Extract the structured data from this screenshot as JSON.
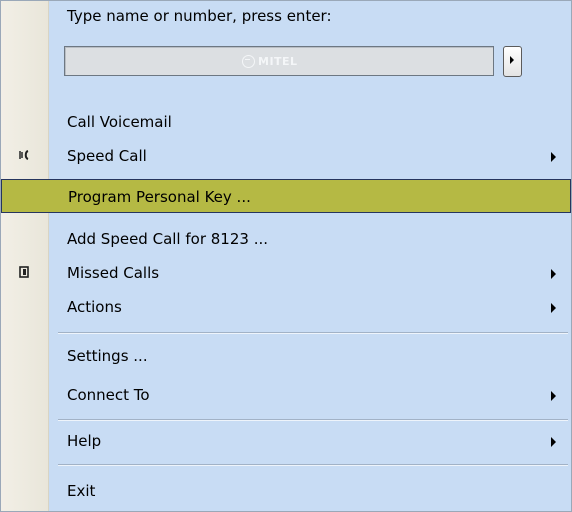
{
  "header": {
    "prompt": "Type name or number, press enter:",
    "input_value": "",
    "logo_text": "MITEL"
  },
  "menu": {
    "call_voicemail": "Call Voicemail",
    "speed_call": "Speed Call",
    "program_personal_key": "Program Personal Key ...",
    "add_speed_call": "Add Speed Call for 8123 ...",
    "missed_calls": "Missed Calls",
    "actions": "Actions",
    "settings": "Settings ...",
    "connect_to": "Connect To",
    "help": "Help",
    "exit": "Exit"
  },
  "colors": {
    "menu_bg": "#c8dcf4",
    "highlight_bg": "#b5b944",
    "highlight_border": "#26355e"
  },
  "icons": {
    "speed_call": "speed-call-icon",
    "missed_calls": "missed-calls-icon"
  }
}
